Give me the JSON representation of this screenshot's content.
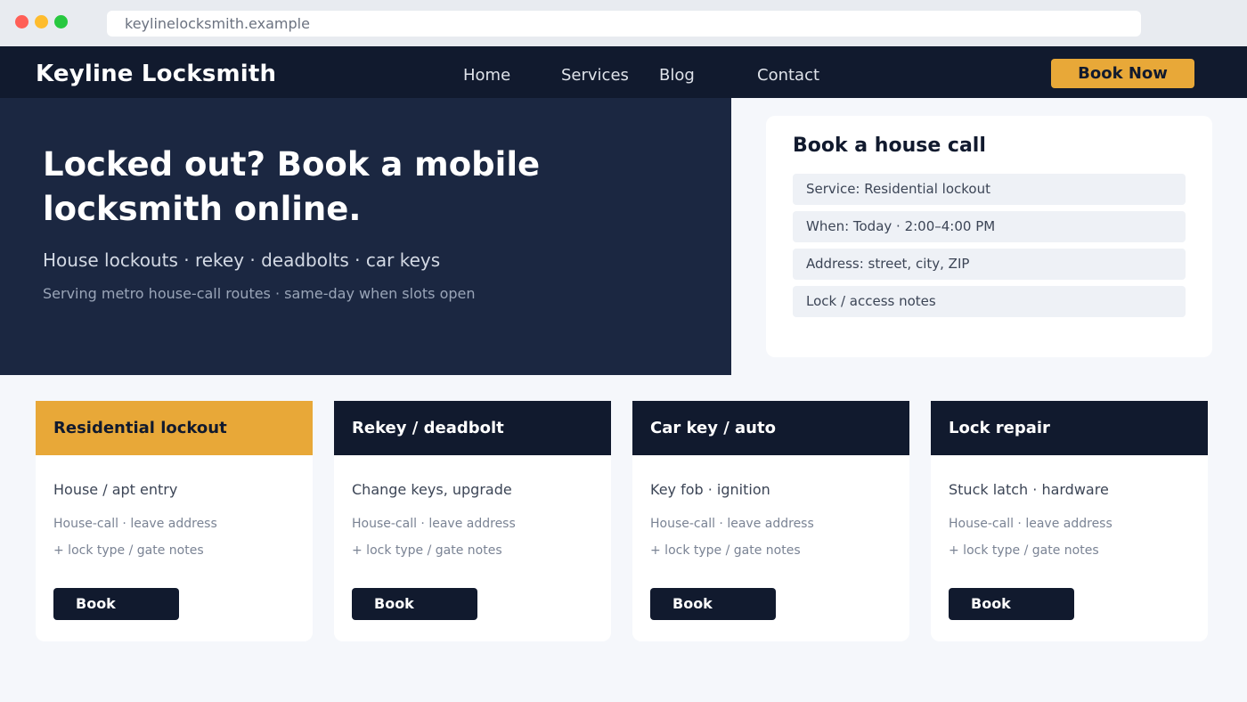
{
  "browser": {
    "url": "keylinelocksmith.example"
  },
  "nav": {
    "brand": "Keyline Locksmith",
    "links": [
      "Home",
      "Services",
      "Blog",
      "Contact"
    ],
    "cta": "Book Now"
  },
  "hero": {
    "title": "Locked out? Book a mobile locksmith online.",
    "subtitle": "House lockouts · rekey · deadbolts · car keys",
    "note": "Serving metro house-call routes · same-day when slots open"
  },
  "booking": {
    "title": "Book a house call",
    "fields": [
      "Service: Residential lockout",
      "When: Today · 2:00–4:00 PM",
      "Address: street, city, ZIP",
      "Lock / access notes"
    ]
  },
  "cards": [
    {
      "title": "Residential lockout",
      "desc": "House / apt entry",
      "meta1": "House-call · leave address",
      "meta2": "+ lock type / gate notes",
      "button": "Book"
    },
    {
      "title": "Rekey / deadbolt",
      "desc": "Change keys, upgrade",
      "meta1": "House-call · leave address",
      "meta2": "+ lock type / gate notes",
      "button": "Book"
    },
    {
      "title": "Car key / auto",
      "desc": "Key fob · ignition",
      "meta1": "House-call · leave address",
      "meta2": "+ lock type / gate notes",
      "button": "Book"
    },
    {
      "title": "Lock repair",
      "desc": "Stuck latch · hardware",
      "meta1": "House-call · leave address",
      "meta2": "+ lock type / gate notes",
      "button": "Book"
    }
  ],
  "colors": {
    "navy": "#111a2e",
    "hero": "#1b2741",
    "accent": "#e8a838",
    "page": "#f5f7fb"
  }
}
